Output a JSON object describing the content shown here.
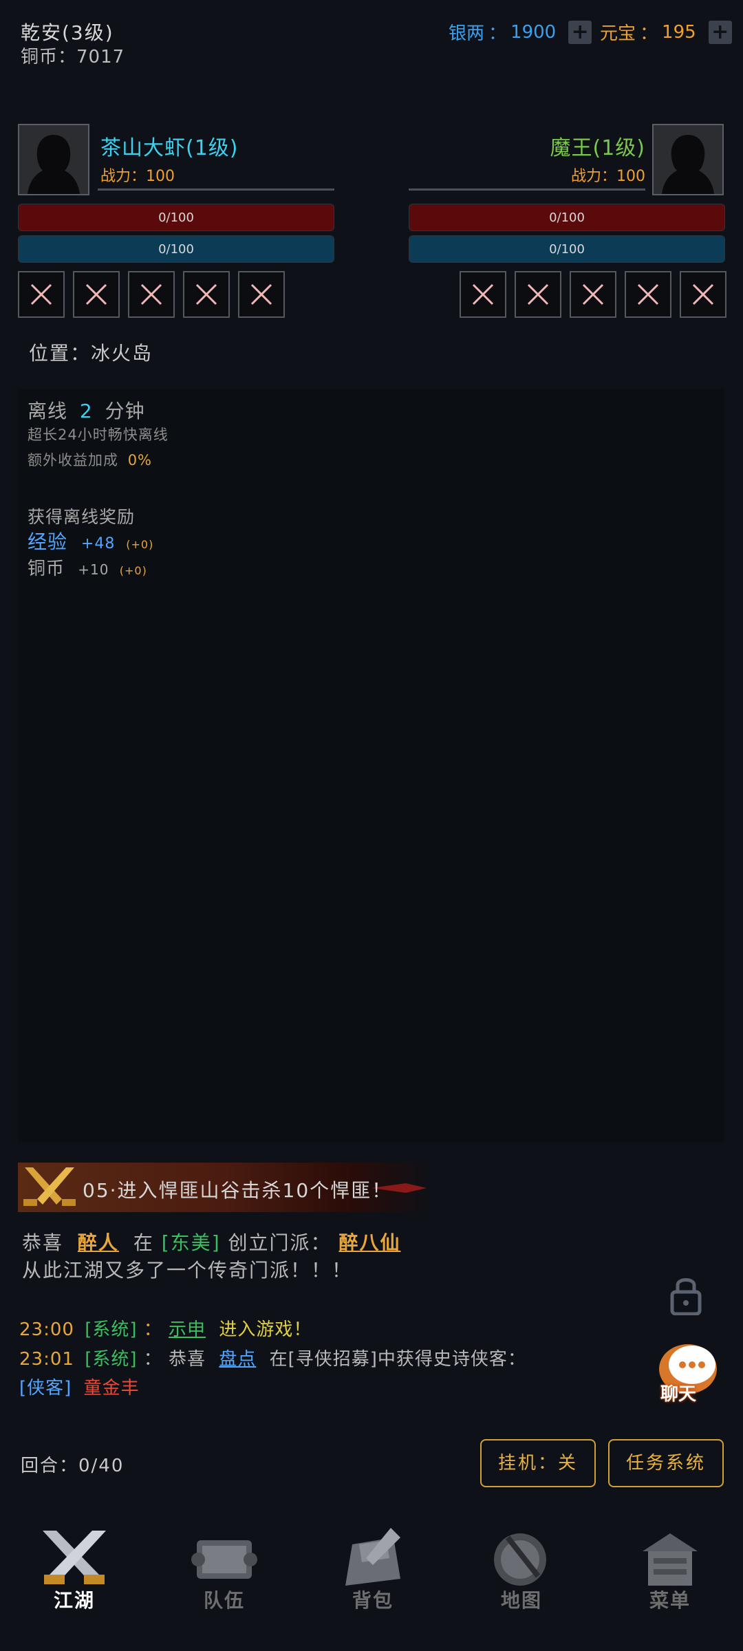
{
  "header": {
    "player_name": "乾安(3级)",
    "copper": "铜币：7017",
    "silver": {
      "label": "银两",
      "sep": "：",
      "value": "1900",
      "color": "#3aa0f0"
    },
    "yuanbao": {
      "label": "元宝",
      "sep": "：",
      "value": "195",
      "color": "#f0a030"
    },
    "plus": "+"
  },
  "player": {
    "name": "茶山大虾(1级)",
    "power": "战力：100",
    "hp": "0/100",
    "mp": "0/100",
    "name_color": "#3ad2f0"
  },
  "enemy": {
    "name": "魔王(1级)",
    "power": "战力：100",
    "hp": "0/100",
    "mp": "0/100",
    "name_color": "#7ac94a"
  },
  "location": "位置：冰火岛",
  "offline": {
    "line1_prefix": "离线",
    "line1_minutes": "2",
    "line1_suffix": "分钟",
    "line2": "超长24小时畅快离线",
    "line3_prefix": "额外收益加成",
    "line3_value": "0%",
    "reward_title": "获得离线奖励",
    "exp_label": "经验",
    "exp_value": "+48",
    "exp_bonus": "(+0)",
    "copper_label": "铜币",
    "copper_value": "+10",
    "copper_bonus": "(+0)"
  },
  "quest_banner": "05·进入悍匪山谷击杀10个悍匪！",
  "news": {
    "p1": "恭喜",
    "player": "醉人",
    "p2": "在",
    "region": "[东美]",
    "p3": "创立门派：",
    "sect": "醉八仙",
    "line2": "从此江湖又多了一个传奇门派！！！"
  },
  "chat": [
    {
      "time": "23:00",
      "tag": "[系统]",
      "colon": "：",
      "name": "示申",
      "msg": "进入游戏！"
    },
    {
      "time": "23:01",
      "tag": "[系统]",
      "colon": "：",
      "p1": "恭喜",
      "name": "盘点",
      "msg": "在[寻侠招募]中获得史诗侠客："
    }
  ],
  "chat_line3": {
    "tag": "[侠客]",
    "name": "童金丰"
  },
  "chat_button_label": "聊天",
  "rounds": "回合：0/40",
  "buttons": {
    "auto": "挂机：关",
    "tasks": "任务系统"
  },
  "nav": [
    "江湖",
    "队伍",
    "背包",
    "地图",
    "菜单"
  ],
  "icons": {
    "lock": "lock-icon",
    "chat": "chat-bubble-icon",
    "nav": [
      "crossed-swords-icon",
      "team-scroll-icon",
      "backpack-icon",
      "map-icon",
      "menu-icon"
    ]
  }
}
